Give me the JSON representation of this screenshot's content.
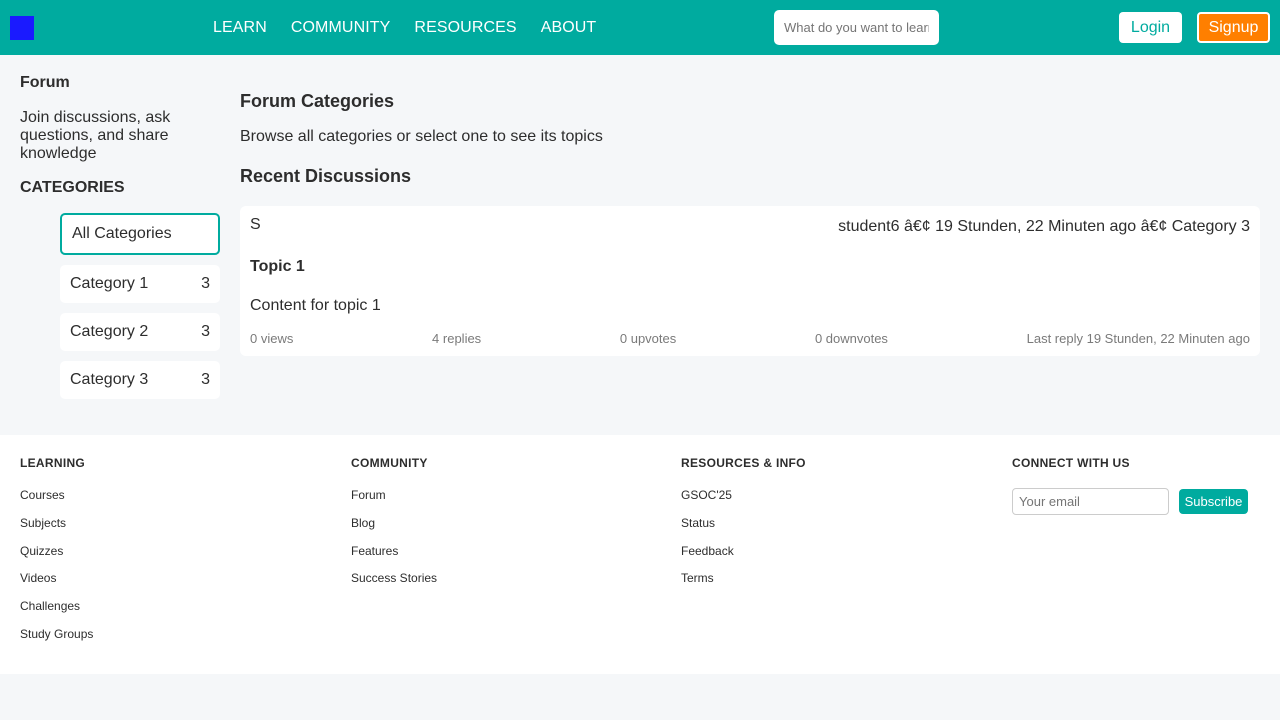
{
  "colors": {
    "header": "#00ab9f",
    "logo": "#1a1aff",
    "signup": "#ff7f00",
    "accent": "#00ab9f"
  },
  "header": {
    "logo_icon": "logo-square-icon",
    "nav": [
      "LEARN",
      "COMMUNITY",
      "RESOURCES",
      "ABOUT"
    ],
    "search_placeholder": "What do you want to learn?",
    "login_label": "Login",
    "signup_label": "Signup"
  },
  "sidebar": {
    "title": "Forum",
    "description": "Join discussions, ask questions, and share knowledge",
    "categories_heading": "CATEGORIES",
    "all_label": "All Categories",
    "categories": [
      {
        "label": "Category 1",
        "count": "3"
      },
      {
        "label": "Category 2",
        "count": "3"
      },
      {
        "label": "Category 3",
        "count": "3"
      }
    ]
  },
  "main": {
    "title": "Forum Categories",
    "subtitle": "Browse all categories or select one to see its topics",
    "recent_title": "Recent Discussions",
    "discussion": {
      "avatar": "S",
      "meta": "student6 â€¢ 19 Stunden, 22 Minuten ago â€¢ Category 3",
      "title": "Topic 1",
      "content": "Content for topic 1",
      "views": "0 views",
      "replies": "4 replies",
      "upvotes": "0 upvotes",
      "downvotes": "0 downvotes",
      "last_reply": "Last reply 19 Stunden, 22 Minuten ago"
    }
  },
  "footer": {
    "learning": {
      "heading": "LEARNING",
      "links": [
        "Courses",
        "Subjects",
        "Quizzes",
        "Videos",
        "Challenges",
        "Study Groups"
      ]
    },
    "community": {
      "heading": "COMMUNITY",
      "links": [
        "Forum",
        "Blog",
        "Features",
        "Success Stories"
      ]
    },
    "resources": {
      "heading": "RESOURCES & INFO",
      "links": [
        "GSOC'25",
        "Status",
        "Feedback",
        "Terms"
      ]
    },
    "connect": {
      "heading": "CONNECT WITH US",
      "email_placeholder": "Your email",
      "subscribe_label": "Subscribe"
    }
  }
}
